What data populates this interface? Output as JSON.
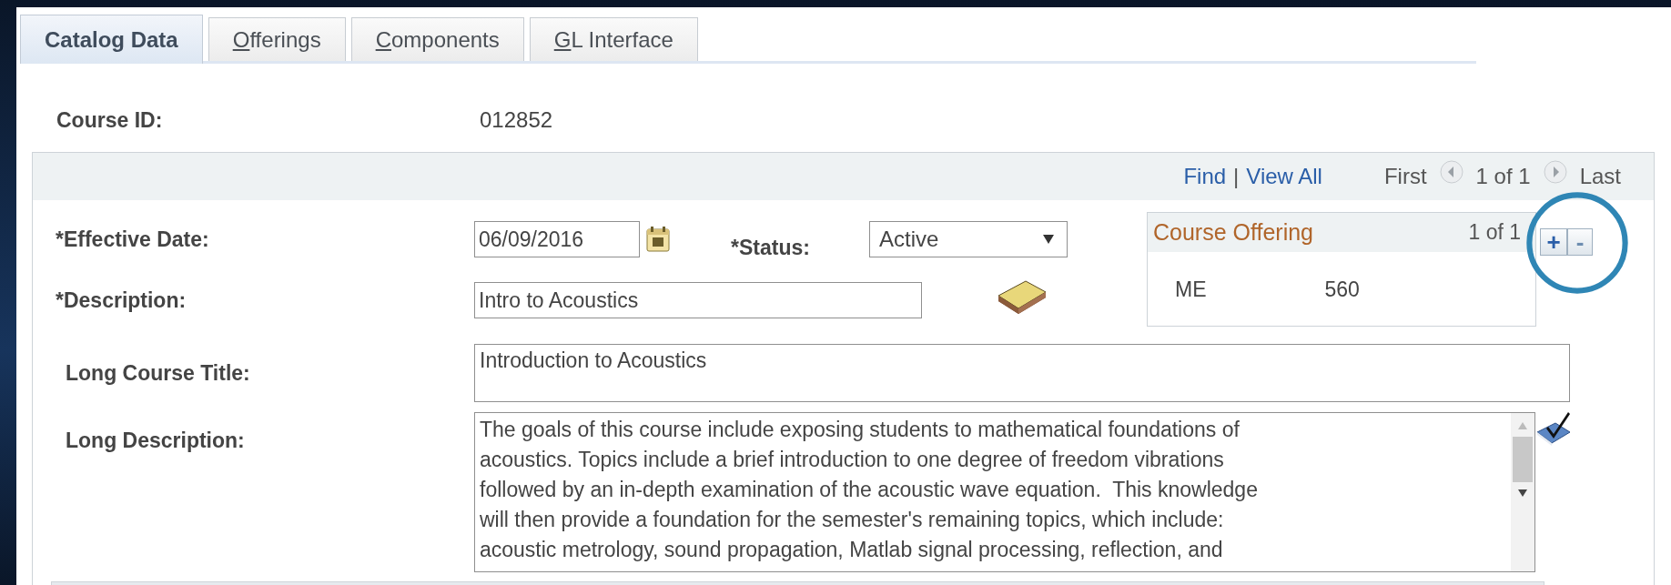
{
  "tabs": [
    {
      "label": "Catalog Data",
      "selected": true
    },
    {
      "label": "Offerings",
      "selected": false,
      "access_key_underlined": true
    },
    {
      "label": "Components",
      "selected": false,
      "access_key_underlined": true
    },
    {
      "label": "GL Interface",
      "selected": false,
      "access_key_underlined": true
    }
  ],
  "course_id": {
    "label": "Course ID:",
    "value": "012852"
  },
  "navigation": {
    "find": "Find",
    "separator": "|",
    "view_all": "View All",
    "first": "First",
    "count": "1 of 1",
    "last": "Last"
  },
  "effective_date": {
    "label": "*Effective Date:",
    "value": "06/09/2016"
  },
  "status": {
    "label": "*Status:",
    "value": "Active"
  },
  "description": {
    "label": "*Description:",
    "value": "Intro to Acoustics"
  },
  "course_offering": {
    "title": "Course Offering",
    "count": "1 of 1",
    "subject": "ME",
    "catalog_number": "560"
  },
  "row_buttons": {
    "add": "+",
    "delete": "-"
  },
  "long_course_title": {
    "label": "Long Course Title:",
    "value": "Introduction to Acoustics"
  },
  "long_description": {
    "label": "Long Description:",
    "lines": [
      "The goals of this course include exposing students to mathematical foundations of",
      "acoustics. Topics include a brief introduction to one degree of freedom vibrations",
      "followed by an in-depth examination of the acoustic wave equation.  This knowledge",
      "will then provide a foundation for the semester's remaining topics, which include:",
      "acoustic metrology, sound propagation, Matlab signal processing, reflection, and"
    ]
  }
}
